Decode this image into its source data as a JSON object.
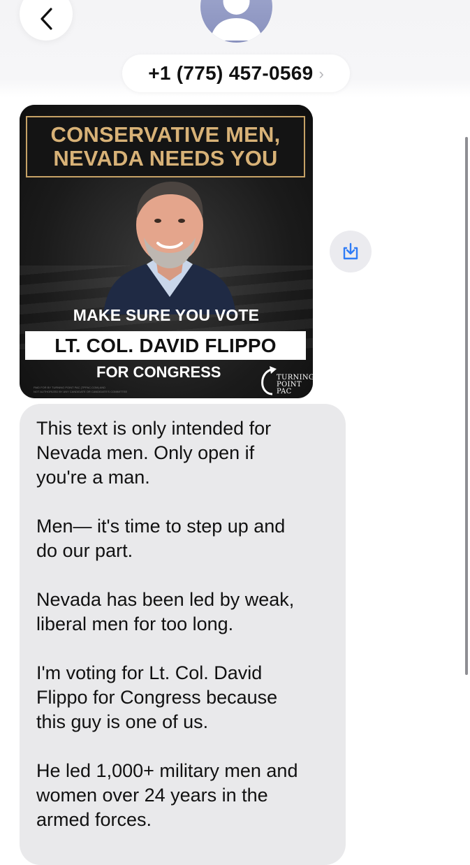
{
  "header": {
    "contact_number": "+1 (775) 457-0569",
    "chevron": "›",
    "back_icon": "chevron-left-icon",
    "avatar_icon": "person-silhouette-icon"
  },
  "message_image": {
    "headline_line1": "CONSERVATIVE MEN,",
    "headline_line2": "NEVADA NEEDS YOU",
    "make_sure": "MAKE SURE YOU VOTE",
    "candidate_name": "LT. COL. DAVID FLIPPO",
    "for_congress": "FOR CONGRESS",
    "logo_line1": "TURNING",
    "logo_line2": "POINT PAC",
    "disclaimer_line1": "PAID FOR BY TURNING POINT PAC (TPPAC.COM) AND",
    "disclaimer_line2": "NOT AUTHORIZED BY ANY CANDIDATE OR CANDIDATE'S COMMITTEE",
    "save_icon": "save-download-icon"
  },
  "message_text": {
    "body": "This text is only intended for\nNevada men. Only open if\nyou're a man.\n\nMen— it's time to step up and\ndo our part.\n\nNevada has been led by weak,\nliberal men for too long.\n\nI'm voting for Lt. Col. David\nFlippo for Congress because\nthis guy is one of us.\n\nHe led 1,000+ military men and\nwomen over 24 years in the\narmed forces."
  },
  "colors": {
    "headline_gold": "#d8b277",
    "bubble_gray": "#e9e9eb",
    "accent_blue": "#2f7cf6",
    "avatar_blue": "#9aa2cc"
  }
}
